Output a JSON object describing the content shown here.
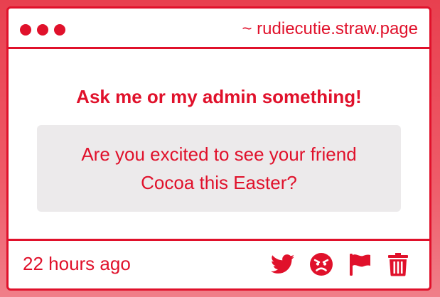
{
  "window": {
    "url": "~ rudiecutie.straw.page"
  },
  "main": {
    "heading": "Ask me or my admin something!",
    "question": "Are you excited to see your friend Cocoa this Easter?"
  },
  "footer": {
    "timestamp": "22 hours ago",
    "actions": [
      {
        "icon": "twitter-icon"
      },
      {
        "icon": "angry-face-icon"
      },
      {
        "icon": "flag-icon"
      },
      {
        "icon": "trash-icon"
      }
    ]
  },
  "colors": {
    "accent": "#e0112b",
    "background": "#e8404f",
    "question_bg": "#eceaeb"
  }
}
